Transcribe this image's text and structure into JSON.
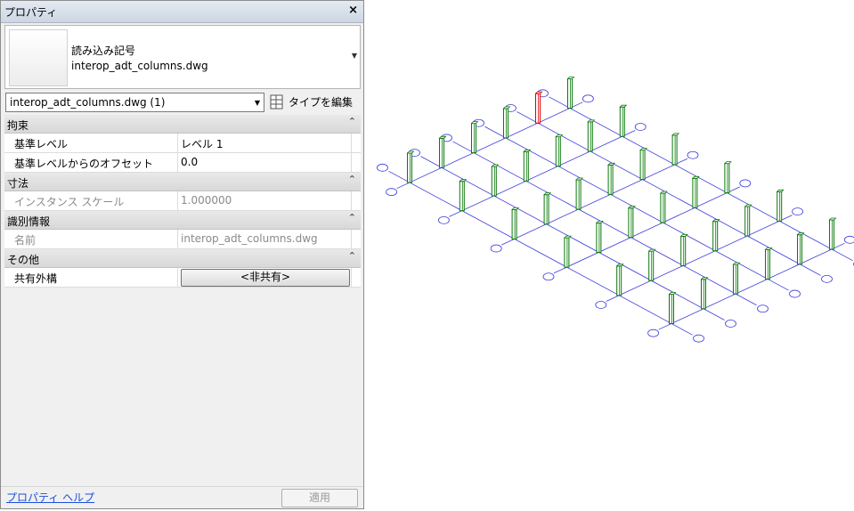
{
  "panel": {
    "title": "プロパティ",
    "close_glyph": "×",
    "type_family": "読み込み記号",
    "type_name": "interop_adt_columns.dwg",
    "selector_value": "interop_adt_columns.dwg (1)",
    "edit_type_label": "タイプを編集",
    "groups": [
      {
        "label": "拘束",
        "collapse_glyph": "⌃",
        "rows": [
          {
            "label": "基準レベル",
            "value": "レベル 1"
          },
          {
            "label": "基準レベルからのオフセット",
            "value": "0.0"
          }
        ]
      },
      {
        "label": "寸法",
        "collapse_glyph": "⌃",
        "rows": [
          {
            "label": "インスタンス スケール",
            "value": "1.000000"
          }
        ]
      },
      {
        "label": "識別情報",
        "collapse_glyph": "⌃",
        "rows": [
          {
            "label": "名前",
            "value": "interop_adt_columns.dwg"
          }
        ]
      },
      {
        "label": "その他",
        "collapse_glyph": "⌃",
        "rows": [
          {
            "label": "共有外構",
            "button_value": "<非共有>"
          }
        ]
      }
    ],
    "help_link": "プロパティ ヘルプ",
    "apply_button": "適用"
  },
  "viewport": {
    "grid_color": "#3c3cdc",
    "column_color": "#0a7a0a",
    "selected_column_color": "#dc0000"
  }
}
